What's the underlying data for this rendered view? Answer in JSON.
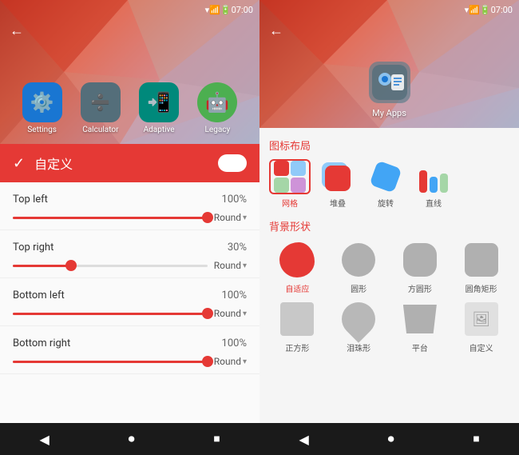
{
  "left": {
    "status_bar": {
      "time": "07:00"
    },
    "back_button": "←",
    "app_icons": [
      {
        "label": "Settings",
        "color": "#1976D2",
        "emoji": "⚙️"
      },
      {
        "label": "Calculator",
        "color": "#546E7A",
        "emoji": "🔢"
      },
      {
        "label": "Adaptive",
        "color": "#00897B",
        "emoji": "📱"
      },
      {
        "label": "Legacy",
        "color": "#4CAF50",
        "emoji": "🤖"
      }
    ],
    "toggle_bar": {
      "check": "✓",
      "label": "自定义"
    },
    "settings": [
      {
        "name": "Top left",
        "value": "100%",
        "fill_pct": 100,
        "dropdown": "Round"
      },
      {
        "name": "Top right",
        "value": "30%",
        "fill_pct": 30,
        "dropdown": "Round"
      },
      {
        "name": "Bottom left",
        "value": "100%",
        "fill_pct": 100,
        "dropdown": "Round"
      },
      {
        "name": "Bottom right",
        "value": "100%",
        "fill_pct": 100,
        "dropdown": "Round"
      }
    ],
    "nav": {
      "back": "◀",
      "home": "⏺",
      "recents": "⏹"
    }
  },
  "right": {
    "status_bar": {
      "time": "07:00"
    },
    "back_button": "←",
    "myapps_label": "My Apps",
    "section_layout": "图标布局",
    "layout_items": [
      {
        "label": "网格",
        "active": true
      },
      {
        "label": "堆叠",
        "active": false
      },
      {
        "label": "旋转",
        "active": false
      },
      {
        "label": "直线",
        "active": false
      }
    ],
    "section_shape": "背景形状",
    "shape_items": [
      {
        "label": "自适应",
        "shape": "adaptive",
        "active": true
      },
      {
        "label": "圆形",
        "shape": "circle",
        "active": false
      },
      {
        "label": "方圆形",
        "shape": "squircle",
        "active": false
      },
      {
        "label": "圆角矩形",
        "shape": "rounded-rect",
        "active": false
      },
      {
        "label": "正方形",
        "shape": "square",
        "active": false
      },
      {
        "label": "泪珠形",
        "shape": "teardrop",
        "active": false
      },
      {
        "label": "平台",
        "shape": "platform",
        "active": false
      },
      {
        "label": "自定义",
        "shape": "custom",
        "active": false
      }
    ],
    "nav": {
      "back": "◀",
      "home": "⏺",
      "recents": "⏹"
    }
  }
}
